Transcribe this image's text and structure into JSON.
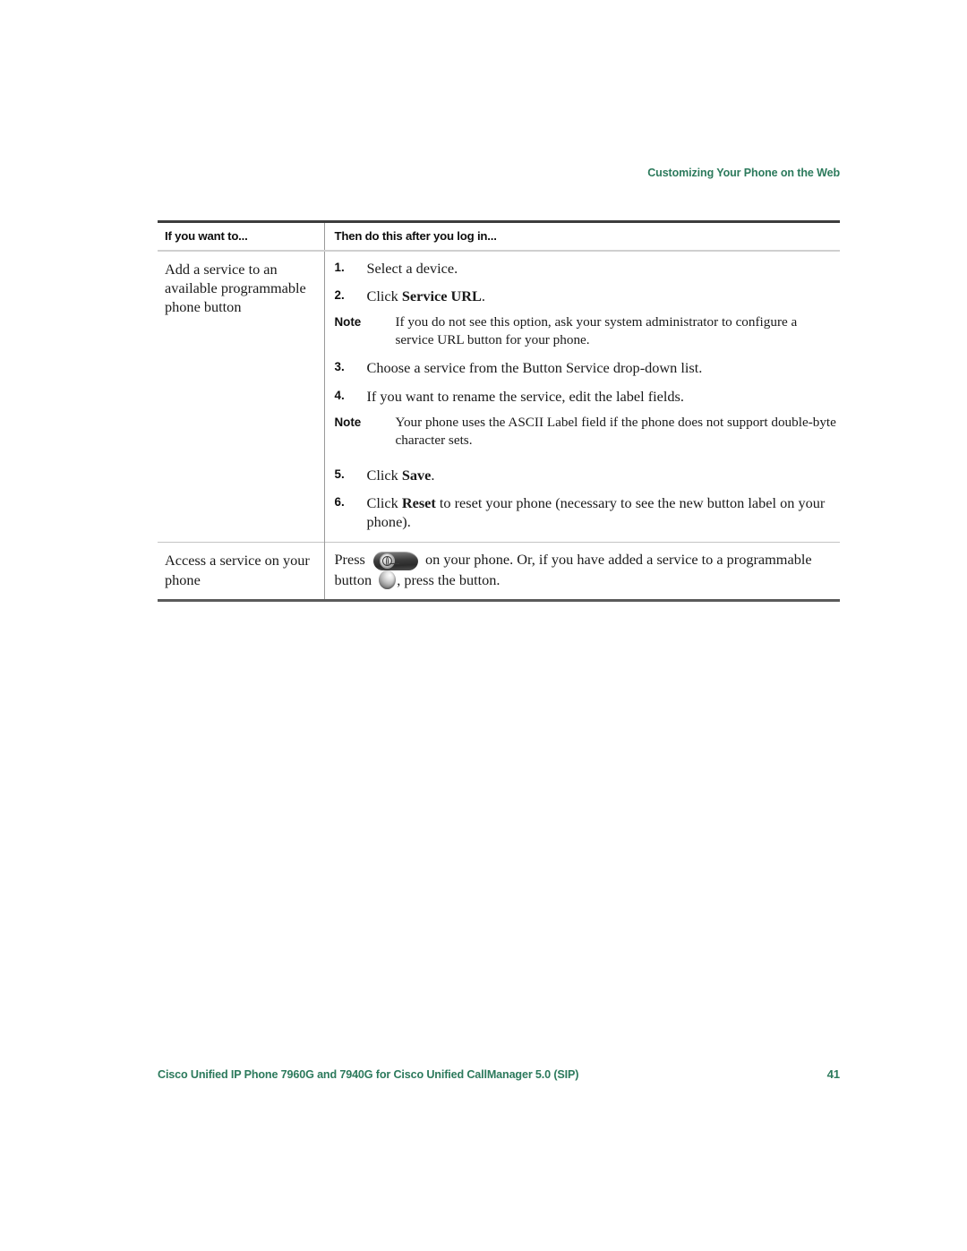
{
  "running_head": "Customizing Your Phone on the Web",
  "accent_color": "#2c7a5c",
  "table": {
    "headers": {
      "col1": "If you want to...",
      "col2": "Then do this after you log in..."
    },
    "rows": [
      {
        "task": "Add a service to an available programmable phone button",
        "steps": [
          {
            "kind": "step",
            "num": "1.",
            "pre": "Select a device.",
            "bold": "",
            "post": ""
          },
          {
            "kind": "step",
            "num": "2.",
            "pre": "Click ",
            "bold": "Service URL",
            "post": "."
          },
          {
            "kind": "note",
            "label": "Note",
            "text": "If you do not see this option, ask your system administrator to configure a service URL button for your phone."
          },
          {
            "kind": "step",
            "num": "3.",
            "pre": "Choose a service from the Button Service drop-down list.",
            "bold": "",
            "post": ""
          },
          {
            "kind": "step",
            "num": "4.",
            "pre": "If you want to rename the service, edit the label fields.",
            "bold": "",
            "post": ""
          },
          {
            "kind": "note",
            "label": "Note",
            "text": "Your phone uses the ASCII Label field if the phone does not support double-byte character sets."
          },
          {
            "kind": "step",
            "num": "5.",
            "pre": "Click ",
            "bold": "Save",
            "post": "."
          },
          {
            "kind": "step",
            "num": "6.",
            "pre": "Click ",
            "bold": "Reset",
            "post": " to reset your phone (necessary to see the new button label on your phone)."
          }
        ]
      },
      {
        "task": "Access a service on your phone",
        "instruction": {
          "seg1": "Press ",
          "icon1": "services-button-icon",
          "seg2": " on your phone. Or, if you have added a service to a programmable button ",
          "icon2": "programmable-button-icon",
          "seg3": ", press the button."
        }
      }
    ]
  },
  "footer": {
    "text": "Cisco Unified IP Phone 7960G and 7940G for Cisco Unified CallManager 5.0 (SIP)",
    "page_number": "41"
  }
}
